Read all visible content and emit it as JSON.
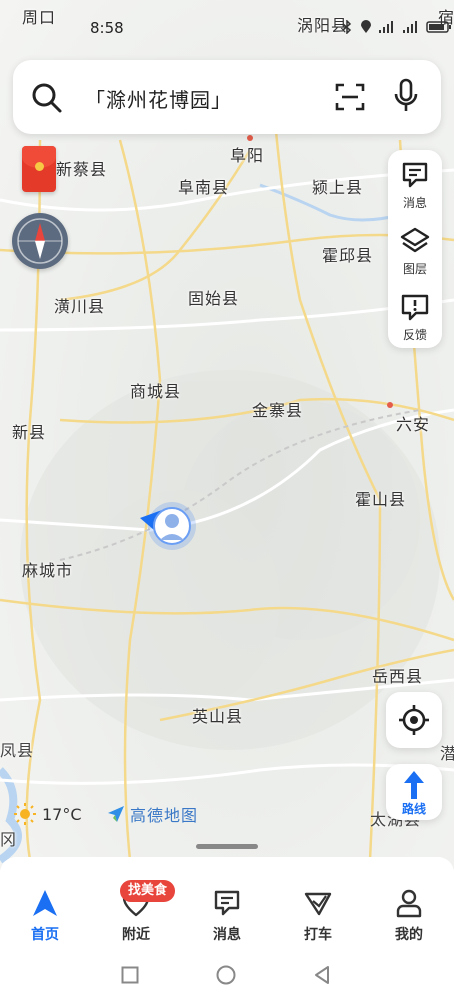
{
  "status_bar": {
    "time": "8:58",
    "top_left_place": "周口",
    "top_mid_place": "涡阳县",
    "top_right_place": "宿"
  },
  "search": {
    "query": "「滁州花博园」"
  },
  "tools": [
    {
      "label": "消息",
      "icon": "message-icon"
    },
    {
      "label": "图层",
      "icon": "layers-icon"
    },
    {
      "label": "反馈",
      "icon": "feedback-icon"
    }
  ],
  "places": {
    "fuyang": "阜阳",
    "funan": "阜南县",
    "yingshang": "颍上县",
    "xincai": "新蔡县",
    "huoqiu": "霍邱县",
    "huangchuan": "潢川县",
    "gushi": "固始县",
    "shangcheng": "商城县",
    "jinzhai": "金寨县",
    "luan": "六安",
    "xinxian": "新县",
    "huoshan": "霍山县",
    "macheng": "麻城市",
    "yuexi": "岳西县",
    "yingshan": "英山县",
    "fengxian_partial": "凤县",
    "qian_partial": "潜",
    "taihu_partial": "太湖县",
    "left_edge_partial": "冈"
  },
  "weather": {
    "temperature": "17°C",
    "icon": "sun-icon"
  },
  "logo": {
    "text": "高德地图"
  },
  "route_button": {
    "label": "路线"
  },
  "tabs": [
    {
      "label": "首页",
      "icon": "navigation-arrow-icon",
      "active": true
    },
    {
      "label": "附近",
      "icon": "heart-location-icon",
      "active": false
    },
    {
      "label": "消息",
      "icon": "message-icon",
      "active": false
    },
    {
      "label": "打车",
      "icon": "taxi-icon",
      "active": false
    },
    {
      "label": "我的",
      "icon": "user-icon",
      "active": false
    }
  ],
  "nearby_badge": "找美食",
  "colors": {
    "accent_blue": "#1a6ff2",
    "badge_red": "#e8453c",
    "road_yellow": "#f5d98a",
    "road_white": "#ffffff"
  }
}
